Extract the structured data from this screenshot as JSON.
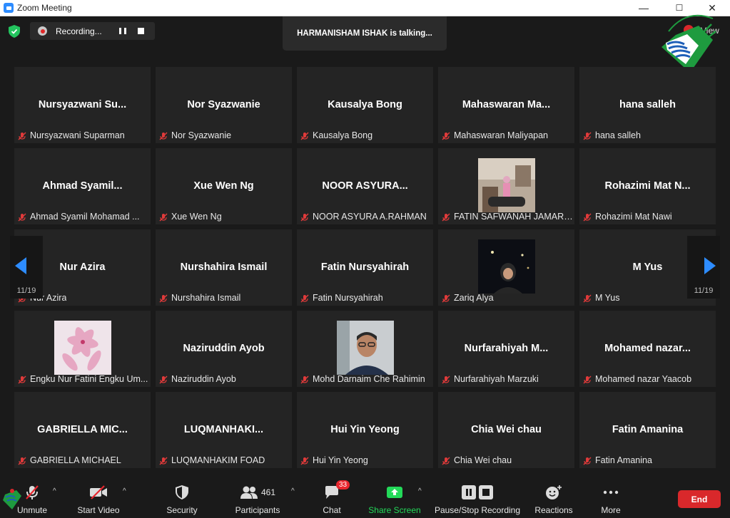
{
  "window": {
    "title": "Zoom Meeting",
    "minimize": "—",
    "maximize": "☐",
    "close": "✕"
  },
  "top": {
    "recording_label": "Recording...",
    "talking": "HARMANISHAM ISHAK is talking...",
    "view_label": "View"
  },
  "pager": {
    "left": "11/19",
    "right": "11/19"
  },
  "tiles": [
    {
      "big": "Nursyazwani  Su...",
      "name": "Nursyazwani Suparman"
    },
    {
      "big": "Nor Syazwanie",
      "name": "Nor Syazwanie"
    },
    {
      "big": "Kausalya Bong",
      "name": "Kausalya Bong"
    },
    {
      "big": "Mahaswaran  Ma...",
      "name": "Mahaswaran Maliyapan"
    },
    {
      "big": "hana salleh",
      "name": "hana salleh"
    },
    {
      "big": "Ahmad  Syamil...",
      "name": "Ahmad Syamil Mohamad ..."
    },
    {
      "big": "Xue Wen Ng",
      "name": "Xue Wen Ng"
    },
    {
      "big": "NOOR  ASYURA...",
      "name": "NOOR ASYURA A.RAHMAN"
    },
    {
      "big": "",
      "name": "FATIN SAFWANAH JAMARU..."
    },
    {
      "big": "Rohazimi  Mat  N...",
      "name": "Rohazimi Mat Nawi"
    },
    {
      "big": "Nur Azira",
      "name": "Nur Azira"
    },
    {
      "big": "Nurshahira Ismail",
      "name": "Nurshahira Ismail"
    },
    {
      "big": "Fatin Nursyahirah",
      "name": "Fatin Nursyahirah"
    },
    {
      "big": "",
      "name": "Zariq Alya"
    },
    {
      "big": "M Yus",
      "name": "M Yus"
    },
    {
      "big": "",
      "name": "Engku Nur Fatini Engku Um..."
    },
    {
      "big": "Naziruddin Ayob",
      "name": "Naziruddin Ayob"
    },
    {
      "big": "",
      "name": "Mohd Darnaim Che Rahimin"
    },
    {
      "big": "Nurfarahiyah  M...",
      "name": "Nurfarahiyah Marzuki"
    },
    {
      "big": "Mohamed  nazar...",
      "name": "Mohamed nazar Yaacob"
    },
    {
      "big": "GABRIELLA  MIC...",
      "name": "GABRIELLA MICHAEL"
    },
    {
      "big": "LUQMANHAKI...",
      "name": "LUQMANHAKIM FOAD"
    },
    {
      "big": "Hui Yin Yeong",
      "name": "Hui Yin Yeong"
    },
    {
      "big": "Chia Wei chau",
      "name": "Chia Wei chau"
    },
    {
      "big": "Fatin Amanina",
      "name": "Fatin Amanina"
    }
  ],
  "toolbar": {
    "unmute": "Unmute",
    "start_video": "Start Video",
    "security": "Security",
    "participants": "Participants",
    "participants_count": "461",
    "chat": "Chat",
    "chat_badge": "33",
    "share_screen": "Share Screen",
    "pause_stop_recording": "Pause/Stop Recording",
    "reactions": "Reactions",
    "more": "More",
    "end": "End"
  },
  "colors": {
    "share_green": "#23d959",
    "end_red": "#d9282b",
    "badge_red": "#e8262e",
    "accent_blue": "#2d8cff"
  }
}
